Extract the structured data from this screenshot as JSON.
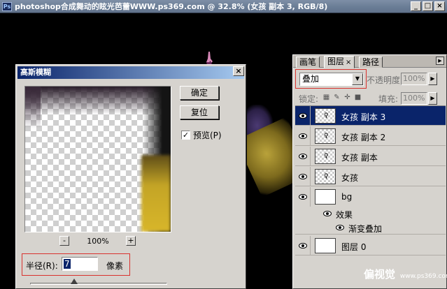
{
  "window": {
    "title": "photoshop合成舞动的眩光芭蕾WWW.ps369.com @ 32.8% (女孩 副本 3, RGB/8)",
    "app_icon": "Ps",
    "controls": [
      "_",
      "□",
      "×"
    ]
  },
  "dialog": {
    "title": "高斯模糊",
    "close": "×",
    "ok_label": "确定",
    "reset_label": "复位",
    "preview_label": "预览(P)",
    "preview_checked": true,
    "zoom_out": "-",
    "zoom_in": "+",
    "zoom_value": "100%",
    "radius_label": "半径(R):",
    "radius_value": "7",
    "radius_unit": "像素",
    "radius_slider_fraction": 0.32
  },
  "panel": {
    "tabs": [
      {
        "label": "画笔",
        "active": false
      },
      {
        "label": "图层",
        "active": true,
        "close": "×"
      },
      {
        "label": "路径",
        "active": false
      }
    ],
    "menu_icon": "▶",
    "blend_mode": "叠加",
    "opacity_label": "不透明度:",
    "opacity_value": "100%",
    "lock_label": "锁定:",
    "fill_label": "填充:",
    "fill_value": "100%",
    "layers": [
      {
        "name": "女孩 副本 3",
        "selected": true,
        "thumb": "checker"
      },
      {
        "name": "女孩 副本 2",
        "selected": false,
        "thumb": "checker"
      },
      {
        "name": "女孩 副本",
        "selected": false,
        "thumb": "checker"
      },
      {
        "name": "女孩",
        "selected": false,
        "thumb": "checker"
      },
      {
        "name": "bg",
        "selected": false,
        "thumb": "plain"
      }
    ],
    "effects_label": "效果",
    "effect_item": "渐变叠加",
    "bottom_layer": "图层 0"
  },
  "watermark": {
    "brand": "偏视觉",
    "url": "www.ps369.com"
  },
  "colors": {
    "selection": "#0a246a",
    "highlight_box": "#d9322e",
    "chrome": "#d6d3ce"
  }
}
